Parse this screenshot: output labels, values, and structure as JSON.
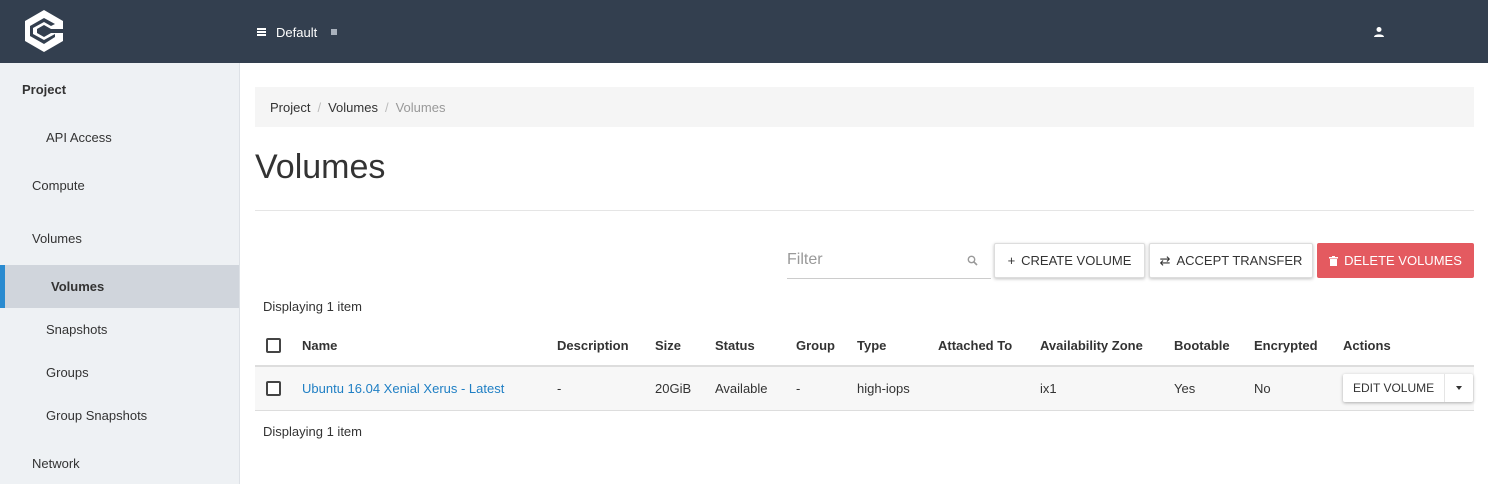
{
  "header": {
    "project_name": "Default"
  },
  "sidebar": {
    "items": [
      {
        "label": "Project"
      },
      {
        "label": "API Access"
      },
      {
        "label": "Compute"
      },
      {
        "label": "Volumes"
      },
      {
        "label": "Volumes"
      },
      {
        "label": "Snapshots"
      },
      {
        "label": "Groups"
      },
      {
        "label": "Group Snapshots"
      },
      {
        "label": "Network"
      }
    ]
  },
  "breadcrumb": [
    "Project",
    "Volumes",
    "Volumes"
  ],
  "main": {
    "title": "Volumes",
    "filter_placeholder": "Filter",
    "create_label": "CREATE VOLUME",
    "accept_label": "ACCEPT TRANSFER",
    "delete_label": "DELETE VOLUMES",
    "count_label": "Displaying 1 item"
  },
  "table": {
    "columns": [
      "Name",
      "Description",
      "Size",
      "Status",
      "Group",
      "Type",
      "Attached To",
      "Availability Zone",
      "Bootable",
      "Encrypted",
      "Actions"
    ],
    "rows": [
      {
        "name": "Ubuntu 16.04 Xenial Xerus - Latest",
        "description": "-",
        "size": "20GiB",
        "status": "Available",
        "group": "-",
        "type": "high-iops",
        "attached_to": "",
        "availability_zone": "ix1",
        "bootable": "Yes",
        "encrypted": "No",
        "action_label": "EDIT VOLUME"
      }
    ]
  },
  "colors": {
    "navbar": "#333f4f",
    "accent": "#2a8bd0",
    "danger": "#e45a60",
    "link": "#1f7fc4"
  }
}
